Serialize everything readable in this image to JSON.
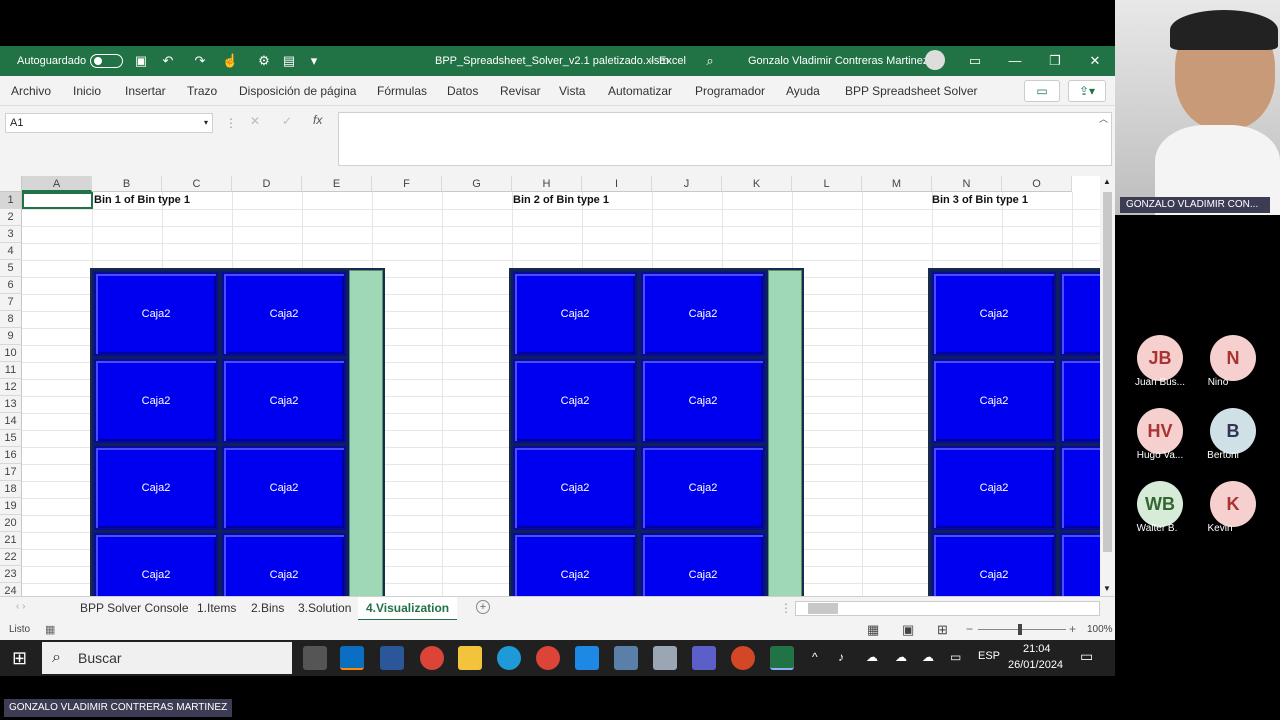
{
  "titlebar": {
    "autosave_label": "Autoguardado",
    "filename": "BPP_Spreadsheet_Solver_v2.1 paletizado.xlsm",
    "separator": "-",
    "app_name": "Excel",
    "user_name": "Gonzalo Vladimir Contreras Martinez"
  },
  "ribbon": {
    "tabs": [
      "Archivo",
      "Inicio",
      "Insertar",
      "Trazo",
      "Disposición de página",
      "Fórmulas",
      "Datos",
      "Revisar",
      "Vista",
      "Automatizar",
      "Programador",
      "Ayuda",
      "BPP Spreadsheet Solver"
    ]
  },
  "formula_bar": {
    "name_box": "A1",
    "fx": "fx"
  },
  "sheet": {
    "columns": [
      "A",
      "B",
      "C",
      "D",
      "E",
      "F",
      "G",
      "H",
      "I",
      "J",
      "K",
      "L",
      "M",
      "N",
      "O"
    ],
    "rows": [
      "1",
      "2",
      "3",
      "4",
      "5",
      "6",
      "7",
      "8",
      "9",
      "10",
      "11",
      "12",
      "13",
      "14",
      "15",
      "16",
      "17",
      "18",
      "19",
      "20",
      "21",
      "22",
      "23",
      "24"
    ],
    "bins": [
      {
        "title": "Bin 1 of Bin type 1",
        "boxes": [
          "Caja2",
          "Caja2",
          "Caja2",
          "Caja2",
          "Caja2",
          "Caja2",
          "Caja2",
          "Caja2"
        ]
      },
      {
        "title": "Bin 2 of Bin type 1",
        "boxes": [
          "Caja2",
          "Caja2",
          "Caja2",
          "Caja2",
          "Caja2",
          "Caja2",
          "Caja2",
          "Caja2"
        ]
      },
      {
        "title": "Bin 3 of Bin type 1",
        "boxes": [
          "Caja2",
          "Caja2",
          "Caja2",
          "Caja2"
        ]
      }
    ]
  },
  "sheet_tabs": {
    "tabs": [
      "BPP Solver Console",
      "1.Items",
      "2.Bins",
      "3.Solution",
      "4.Visualization"
    ],
    "active": "4.Visualization"
  },
  "statusbar": {
    "status": "Listo",
    "zoom": "100%"
  },
  "taskbar": {
    "search_placeholder": "Buscar",
    "lang": "ESP",
    "time": "21:04",
    "date": "26/01/2024"
  },
  "meeting": {
    "presenter_label": "GONZALO VLADIMIR CON...",
    "bottom_label": "GONZALO VLADIMIR CONTRERAS MARTINEZ",
    "participants": [
      {
        "initials": "JB",
        "name": "Juan Bus...",
        "color": "#f5d0cf"
      },
      {
        "initials": "N",
        "name": "Nino",
        "color": "#f5d0cf"
      },
      {
        "initials": "HV",
        "name": "Hugo Va...",
        "color": "#f5d0cf"
      },
      {
        "initials": "B",
        "name": "Bertoni",
        "color": "#cfe0e6"
      },
      {
        "initials": "WB",
        "name": "Walter B.",
        "color": "#d6ecd9"
      },
      {
        "initials": "K",
        "name": "Kevin",
        "color": "#f5d0cf"
      }
    ]
  }
}
